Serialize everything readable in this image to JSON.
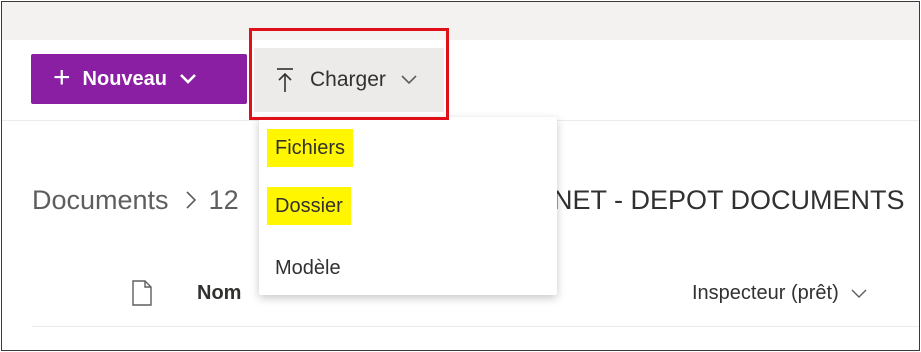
{
  "toolbar": {
    "new_label": "Nouveau",
    "upload_label": "Charger"
  },
  "upload_menu": {
    "items": [
      "Fichiers",
      "Dossier",
      "Modèle"
    ],
    "highlight_color": "#fff600"
  },
  "breadcrumb": {
    "root": "Documents",
    "partial_visible": "12",
    "tail_visible": "NET - DEPOT DOCUMENTS"
  },
  "list_header": {
    "name_col": "Nom",
    "inspector_col": "Inspecteur (prêt)"
  },
  "colors": {
    "new_button": "#8b1fa3",
    "upload_button_bg": "#edebe9",
    "annotation_border": "#e0101a"
  },
  "icons": [
    "plus-icon",
    "chevron-down-icon",
    "upload-arrow-icon",
    "chevron-right-icon",
    "file-icon"
  ]
}
